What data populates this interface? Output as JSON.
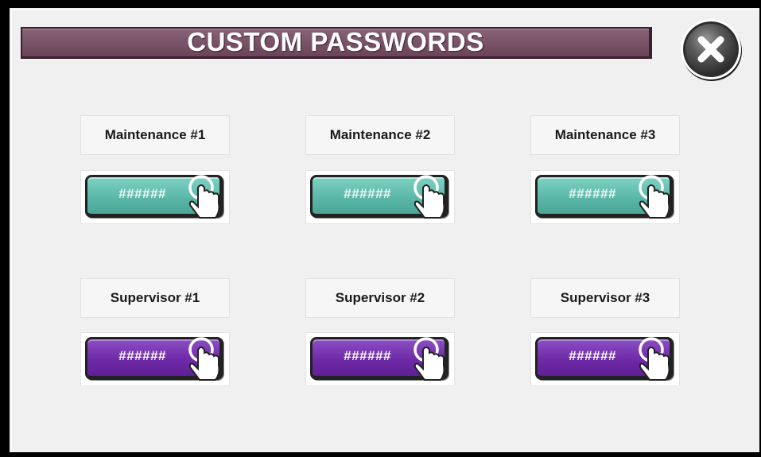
{
  "header": {
    "title": "CUSTOM PASSWORDS",
    "close_icon": "close-x-icon"
  },
  "colors": {
    "title_bar": "#7a5468",
    "maintenance_button": "#5bb8a8",
    "supervisor_button": "#6f2aa8",
    "panel_background": "#f0f0f0"
  },
  "maintenance": [
    {
      "label": "Maintenance #1",
      "value": "######"
    },
    {
      "label": "Maintenance #2",
      "value": "######"
    },
    {
      "label": "Maintenance #3",
      "value": "######"
    }
  ],
  "supervisor": [
    {
      "label": "Supervisor #1",
      "value": "######"
    },
    {
      "label": "Supervisor #2",
      "value": "######"
    },
    {
      "label": "Supervisor #3",
      "value": "######"
    }
  ],
  "icons": {
    "button_icon": "touch-hand-icon"
  }
}
